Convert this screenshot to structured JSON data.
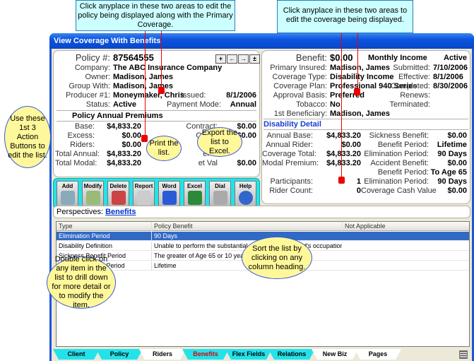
{
  "window": {
    "title": "View Coverage With Benefits"
  },
  "callouts": {
    "policy_area": "Click anyplace in these two areas to edit the policy being displayed along with the Primary Coverage.",
    "coverage_area": "Click anyplace in these two areas to edit the coverage being displayed.",
    "action_buttons": "Use these 1st 3 Action Buttons to edit the list.",
    "print": "Print the list.",
    "excel": "Export the list to Excel.",
    "drill": "Double click on any item in the list to drill down for more detail or to modify the item.",
    "sort": "Sort the list by clicking on any column heading."
  },
  "policy": {
    "policy_label": "Policy #:",
    "policy_no": "87564555",
    "company_label": "Company:",
    "company": "The ABC Insurance Company",
    "owner_label": "Owner:",
    "owner": "Madison, James",
    "group_label": "Group With:",
    "group": "Madison, James",
    "producer_label": "Producer #1:",
    "producer": "Moneymaker, Chris",
    "issued_label": "Issued:",
    "issued": "8/1/2006",
    "status_label": "Status:",
    "status": "Active",
    "paymode_label": "Payment Mode:",
    "paymode": "Annual",
    "nav_buttons": [
      "+",
      "←",
      "→",
      "±"
    ]
  },
  "premiums": {
    "title": "Policy Annual Premiums",
    "left": [
      {
        "label": "Base:",
        "value": "$4,833.20"
      },
      {
        "label": "Excess:",
        "value": "$0.00"
      },
      {
        "label": "Riders:",
        "value": "$0.00"
      },
      {
        "label": "Total Annual:",
        "value": "$4,833.20"
      },
      {
        "label": "Total Modal:",
        "value": "$4,833.20"
      }
    ],
    "right": [
      {
        "label": "Contract:",
        "value": "$0.00"
      },
      {
        "label": "Other:",
        "value": "$0.00"
      },
      {
        "label": "L",
        "value": ""
      },
      {
        "label": "er C",
        "value": ""
      },
      {
        "label": "et Val",
        "value": "$0.00"
      }
    ]
  },
  "coverage": {
    "benefit_label": "Benefit:",
    "benefit": "$0.00",
    "frequency": "Monthly Income",
    "status": "Active",
    "left": [
      {
        "label": "Primary Insured:",
        "value": "Madison, James"
      },
      {
        "label": "Coverage Type:",
        "value": "Disability Income"
      },
      {
        "label": "Coverage Plan:",
        "value": "Professional 940 Series"
      },
      {
        "label": "Approval Basis:",
        "value": "Preferred"
      },
      {
        "label": "Tobacco:",
        "value": "No"
      },
      {
        "label": "1st Beneficiary:",
        "value": "Madison, James"
      }
    ],
    "right": [
      {
        "label": "Submitted:",
        "value": "7/10/2006"
      },
      {
        "label": "Effective:",
        "value": "8/1/2006"
      },
      {
        "label": "Completed:",
        "value": "8/30/2006"
      },
      {
        "label": "Renews:",
        "value": ""
      },
      {
        "label": "Terminated:",
        "value": ""
      }
    ]
  },
  "disability": {
    "title": "Disability Detail",
    "left": [
      {
        "label": "Annual Base:",
        "value": "$4,833.20"
      },
      {
        "label": "Annual Rider:",
        "value": "$0.00"
      },
      {
        "label": "Coverage Total:",
        "value": "$4,833.20"
      },
      {
        "label": "Modal Premium:",
        "value": "$4,833.20"
      },
      {
        "label": "",
        "value": ""
      },
      {
        "label": "Participants:",
        "value": "1"
      },
      {
        "label": "Rider Count:",
        "value": "0"
      }
    ],
    "right": [
      {
        "label": "Sickness Benefit:",
        "value": "$0.00"
      },
      {
        "label": "Benefit Period:",
        "value": "Lifetime"
      },
      {
        "label": "Elimination Period:",
        "value": "90 Days"
      },
      {
        "label": "Accident Benefit:",
        "value": "$0.00"
      },
      {
        "label": "Benefit Period:",
        "value": "To Age 65"
      },
      {
        "label": "Elimination Period:",
        "value": "90 Days"
      },
      {
        "label": "Coverage Cash Value",
        "value": "$0.00"
      }
    ]
  },
  "toolbar": {
    "buttons": [
      "Add",
      "Modify",
      "Delete",
      "Report",
      "Word",
      "Excel",
      "Dial",
      "Help"
    ]
  },
  "perspectives": {
    "label": "Perspectives:",
    "link": "Benefits"
  },
  "grid": {
    "columns": [
      "Type",
      "Policy Benefit",
      "Not Applicable"
    ],
    "rows": [
      [
        "Elimination Period",
        "90 Days",
        ""
      ],
      [
        "Disability Definition",
        "Unable to perform the substantial duties of the insured's occupation",
        ""
      ],
      [
        "Sickness Benefit Period",
        "The greater of Age 65 or 10 years",
        ""
      ],
      [
        "Accident Benefit Period",
        "Lifetime",
        ""
      ]
    ],
    "selected_row": 0
  },
  "tabs": [
    {
      "label": "Client",
      "color": "#22e3ea"
    },
    {
      "label": "Policy",
      "color": "#22e3ea"
    },
    {
      "label": "Riders",
      "color": "#ffffff"
    },
    {
      "label": "Benefits",
      "color": "#22e3ea",
      "active": true
    },
    {
      "label": "Flex Fields",
      "color": "#22e3ea"
    },
    {
      "label": "Relations",
      "color": "#22e3ea"
    },
    {
      "label": "New Biz",
      "color": "#ffffff"
    },
    {
      "label": "Pages",
      "color": "#ffffff"
    }
  ]
}
